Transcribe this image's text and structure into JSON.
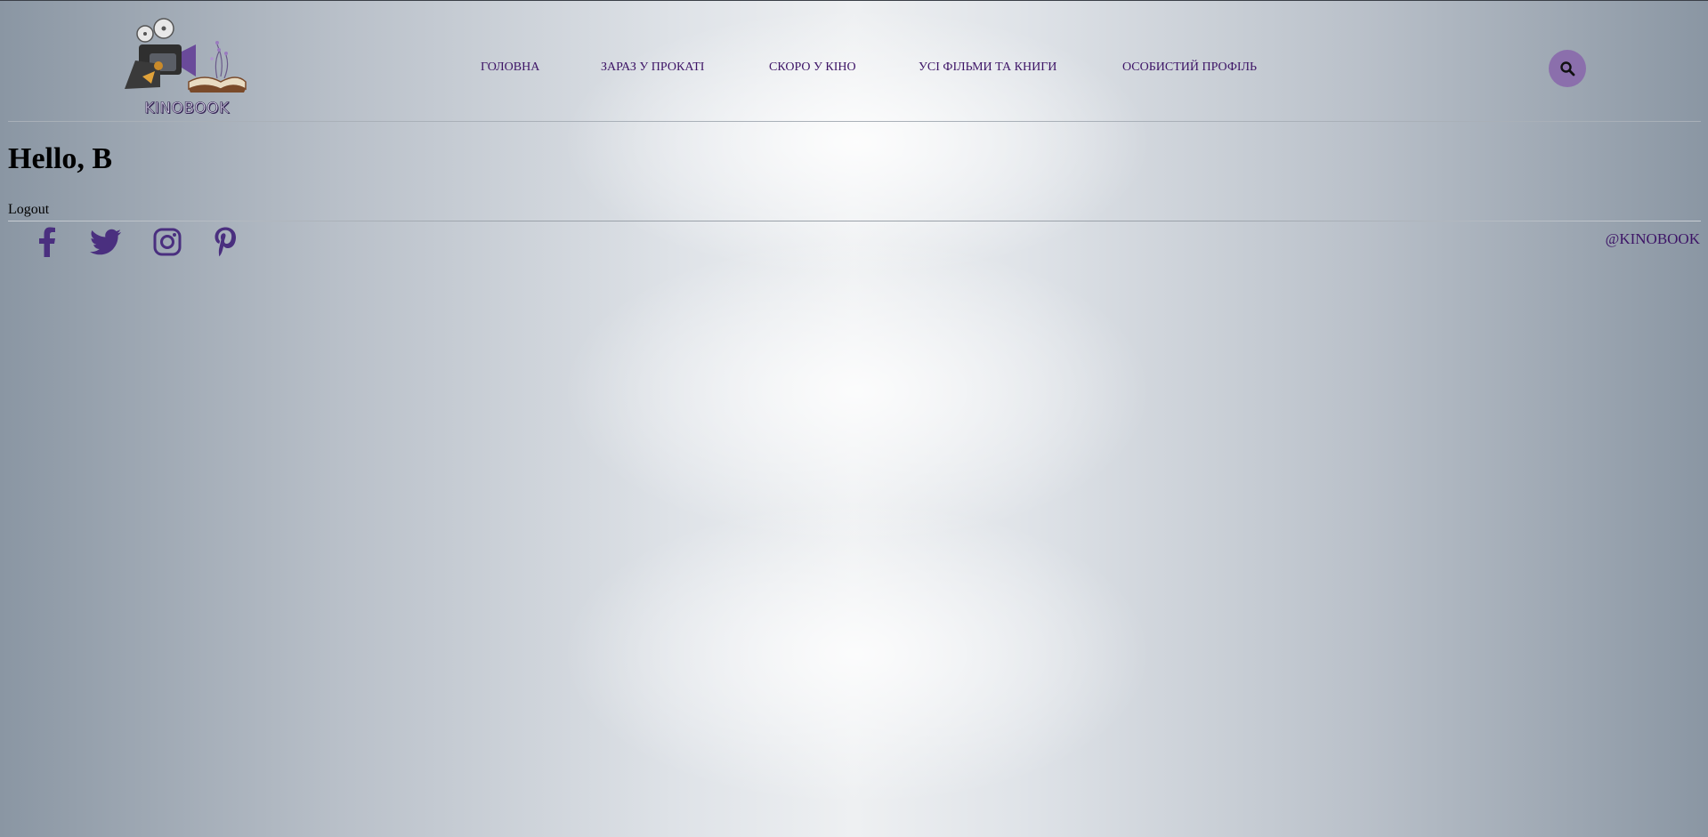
{
  "header": {
    "logo_text": "KINOBOOK",
    "nav": [
      {
        "label": "ГОЛОВНА"
      },
      {
        "label": "ЗАРАЗ У ПРОКАТІ"
      },
      {
        "label": "СКОРО У КІНО"
      },
      {
        "label": "УСІ ФІЛЬМИ ТА КНИГИ"
      },
      {
        "label": "ОСОБИСТИЙ ПРОФІЛЬ"
      }
    ],
    "search_icon": "search-icon"
  },
  "main": {
    "greeting": "Hello, B",
    "logout_label": "Logout"
  },
  "footer": {
    "social": [
      {
        "icon": "facebook-icon"
      },
      {
        "icon": "twitter-icon"
      },
      {
        "icon": "instagram-icon"
      },
      {
        "icon": "pinterest-icon"
      }
    ],
    "handle": "@KINOBOOK"
  },
  "colors": {
    "accent": "#8b6fac",
    "nav_text": "#3d1466",
    "social_icon": "#4a2f7f"
  }
}
